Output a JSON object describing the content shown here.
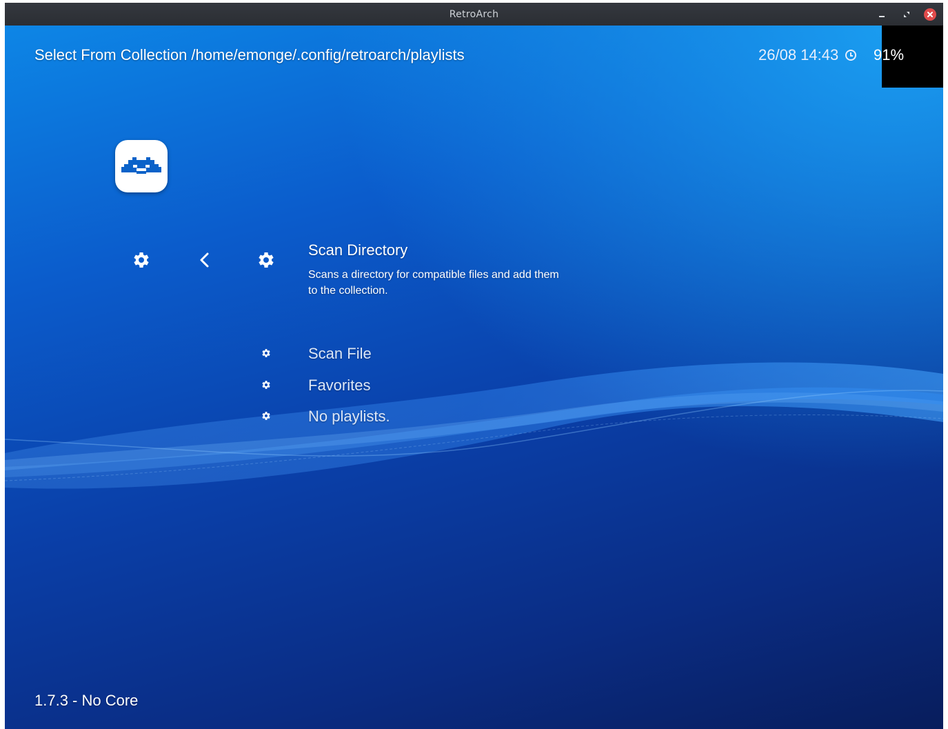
{
  "window": {
    "title": "RetroArch",
    "controls": {
      "minimize": "minimize-icon",
      "restore": "restore-icon",
      "close": "close-icon"
    }
  },
  "header": {
    "title": "Select From Collection /home/emonge/.config/retroarch/playlists",
    "datetime": "26/08 14:43",
    "battery": "91%"
  },
  "sidebar": {
    "logo": "retroarch-invader-icon",
    "main_icon": "gear-icon",
    "back_icon": "chevron-left-icon"
  },
  "menu": {
    "selected": {
      "title": "Scan Directory",
      "description": "Scans a directory for compatible files and add them to the collection.",
      "icon": "gear-icon"
    },
    "items": [
      {
        "label": "Scan File",
        "icon": "gear-icon"
      },
      {
        "label": "Favorites",
        "icon": "gear-icon"
      },
      {
        "label": "No playlists.",
        "icon": "gear-icon"
      }
    ]
  },
  "footer": {
    "version": "1.7.3 - No Core"
  },
  "colors": {
    "titlebar": "#2b2e33",
    "background_top": "#0d86e6",
    "background_bottom": "#081d5c",
    "close_button": "#e04b4b"
  }
}
